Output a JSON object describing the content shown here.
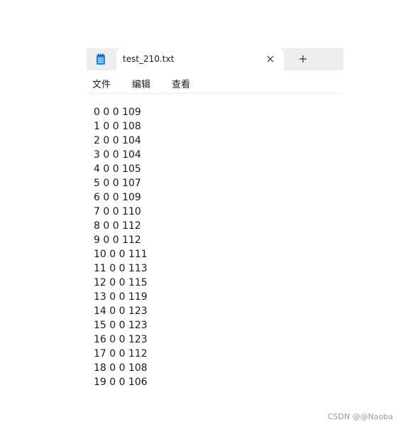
{
  "tab": {
    "title": "test_210.txt",
    "close_symbol": "✕",
    "new_tab_symbol": "+"
  },
  "menu": {
    "items": [
      "文件",
      "编辑",
      "查看"
    ]
  },
  "editor": {
    "lines": [
      "0 0 0 109",
      "1 0 0 108",
      "2 0 0 104",
      "3 0 0 104",
      "4 0 0 105",
      "5 0 0 107",
      "6 0 0 109",
      "7 0 0 110",
      "8 0 0 112",
      "9 0 0 112",
      "10 0 0 111",
      "11 0 0 113",
      "12 0 0 115",
      "13 0 0 119",
      "14 0 0 123",
      "15 0 0 123",
      "16 0 0 123",
      "17 0 0 112",
      "18 0 0 108",
      "19 0 0 106"
    ]
  },
  "watermark": "CSDN @@Naoba",
  "colors": {
    "app_icon": "#1e88e5",
    "titlebar": "#eeeeee"
  },
  "icons": {
    "app": "notepad-icon",
    "close": "close-icon",
    "new_tab": "plus-icon"
  }
}
